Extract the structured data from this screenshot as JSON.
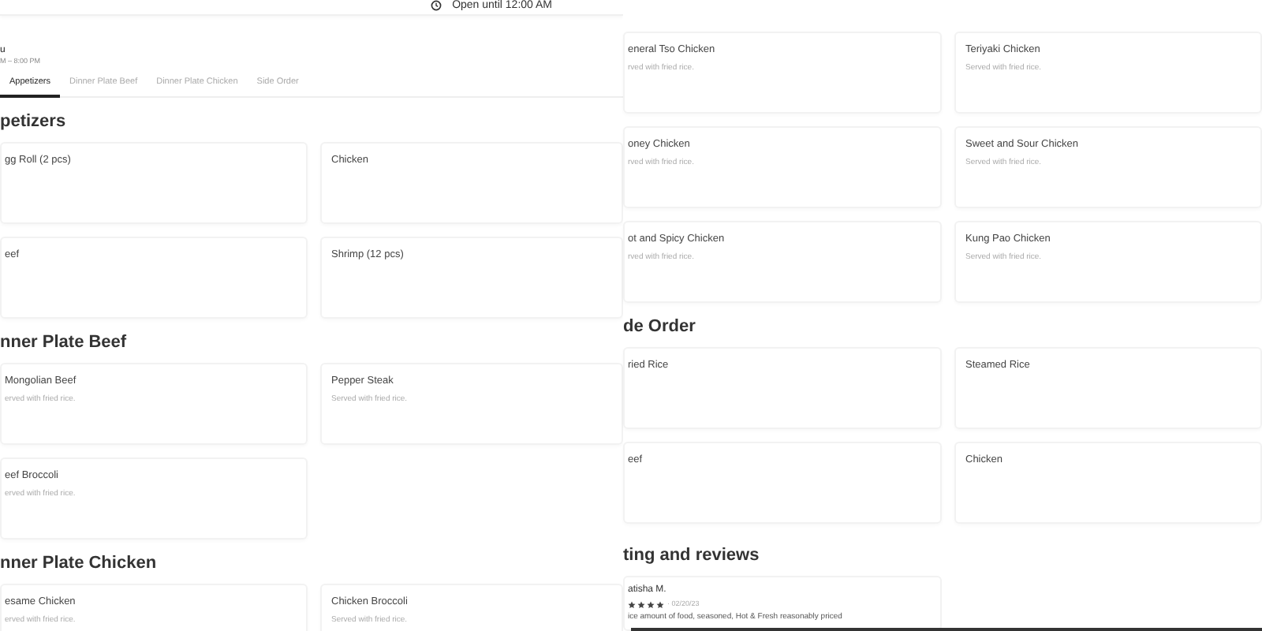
{
  "left": {
    "open_status": "Open until 12:00 AM",
    "menu": {
      "title": "u",
      "hours": "M – 8:00 PM"
    },
    "tabs": [
      {
        "label": "Appetizers",
        "selected": true
      },
      {
        "label": "Dinner Plate Beef",
        "selected": false
      },
      {
        "label": "Dinner Plate Chicken",
        "selected": false
      },
      {
        "label": "Side Order",
        "selected": false
      }
    ],
    "sections": [
      {
        "title": "petizers",
        "items": [
          {
            "name": "gg Roll (2 pcs)"
          },
          {
            "name": "Chicken"
          },
          {
            "name": "eef"
          },
          {
            "name": "Shrimp (12 pcs)"
          }
        ]
      },
      {
        "title": "nner Plate Beef",
        "items": [
          {
            "name": "Mongolian Beef",
            "description": "erved with fried rice."
          },
          {
            "name": "Pepper Steak",
            "description": "Served with fried rice."
          },
          {
            "name": "eef Broccoli",
            "description": "erved with fried rice."
          }
        ]
      },
      {
        "title": "nner Plate Chicken",
        "items": [
          {
            "name": "esame Chicken",
            "description": "erved with fried rice."
          },
          {
            "name": "Chicken Broccoli",
            "description": "Served with fried rice."
          }
        ]
      }
    ]
  },
  "right": {
    "sections": [
      {
        "items": [
          {
            "name": "eneral Tso Chicken",
            "description": "rved with fried rice."
          },
          {
            "name": "Teriyaki Chicken",
            "description": "Served with fried rice."
          },
          {
            "name": "oney Chicken",
            "description": "rved with fried rice."
          },
          {
            "name": "Sweet and Sour Chicken",
            "description": "Served with fried rice."
          },
          {
            "name": "ot and Spicy Chicken",
            "description": "rved with fried rice."
          },
          {
            "name": "Kung Pao Chicken",
            "description": "Served with fried rice."
          }
        ]
      },
      {
        "title": "de Order",
        "items": [
          {
            "name": "ried Rice"
          },
          {
            "name": "Steamed Rice"
          },
          {
            "name": "eef"
          },
          {
            "name": "Chicken"
          }
        ]
      }
    ],
    "reviews": {
      "title": "ting and reviews",
      "items": [
        {
          "author": "atisha M.",
          "stars": 4,
          "date": "· 02/20/23",
          "text": "ice amount of food, seasoned, Hot & Fresh reasonably priced"
        }
      ]
    }
  }
}
